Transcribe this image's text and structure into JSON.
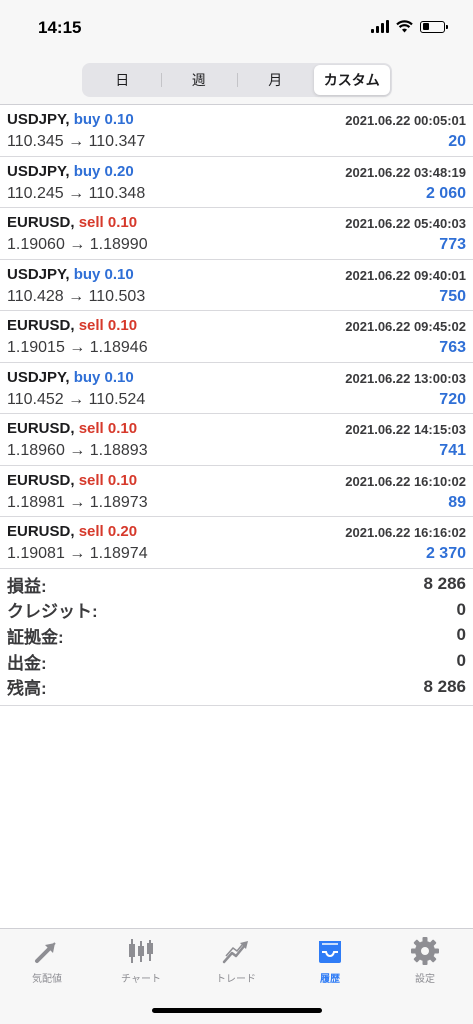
{
  "status": {
    "time": "14:15"
  },
  "tabs_period": [
    {
      "label": "日",
      "active": false
    },
    {
      "label": "週",
      "active": false
    },
    {
      "label": "月",
      "active": false
    },
    {
      "label": "カスタム",
      "active": true
    }
  ],
  "deals": [
    {
      "symbol": "USDJPY,",
      "side": "buy",
      "volume": "buy 0.10",
      "open": "110.345",
      "close": "110.347",
      "time": "2021.06.22 00:05:01",
      "profit": "20"
    },
    {
      "symbol": "USDJPY,",
      "side": "buy",
      "volume": "buy 0.20",
      "open": "110.245",
      "close": "110.348",
      "time": "2021.06.22 03:48:19",
      "profit": "2 060"
    },
    {
      "symbol": "EURUSD,",
      "side": "sell",
      "volume": "sell 0.10",
      "open": "1.19060",
      "close": "1.18990",
      "time": "2021.06.22 05:40:03",
      "profit": "773"
    },
    {
      "symbol": "USDJPY,",
      "side": "buy",
      "volume": "buy 0.10",
      "open": "110.428",
      "close": "110.503",
      "time": "2021.06.22 09:40:01",
      "profit": "750"
    },
    {
      "symbol": "EURUSD,",
      "side": "sell",
      "volume": "sell 0.10",
      "open": "1.19015",
      "close": "1.18946",
      "time": "2021.06.22 09:45:02",
      "profit": "763"
    },
    {
      "symbol": "USDJPY,",
      "side": "buy",
      "volume": "buy 0.10",
      "open": "110.452",
      "close": "110.524",
      "time": "2021.06.22 13:00:03",
      "profit": "720"
    },
    {
      "symbol": "EURUSD,",
      "side": "sell",
      "volume": "sell 0.10",
      "open": "1.18960",
      "close": "1.18893",
      "time": "2021.06.22 14:15:03",
      "profit": "741"
    },
    {
      "symbol": "EURUSD,",
      "side": "sell",
      "volume": "sell 0.10",
      "open": "1.18981",
      "close": "1.18973",
      "time": "2021.06.22 16:10:02",
      "profit": "89"
    },
    {
      "symbol": "EURUSD,",
      "side": "sell",
      "volume": "sell 0.20",
      "open": "1.19081",
      "close": "1.18974",
      "time": "2021.06.22 16:16:02",
      "profit": "2 370"
    }
  ],
  "arrow": "→",
  "summary": [
    {
      "label": "損益:",
      "value": "8 286"
    },
    {
      "label": "クレジット:",
      "value": "0"
    },
    {
      "label": "証拠金:",
      "value": "0"
    },
    {
      "label": "出金:",
      "value": "0"
    },
    {
      "label": "残高:",
      "value": "8 286"
    }
  ],
  "tabbar": [
    {
      "label": "気配値",
      "icon": "quotes-icon",
      "active": false
    },
    {
      "label": "チャート",
      "icon": "chart-icon",
      "active": false
    },
    {
      "label": "トレード",
      "icon": "trade-icon",
      "active": false
    },
    {
      "label": "履歴",
      "icon": "history-icon",
      "active": true
    },
    {
      "label": "設定",
      "icon": "settings-icon",
      "active": false
    }
  ],
  "colors": {
    "buy": "#2f6fd6",
    "sell": "#d6392b",
    "profit": "#2f6fd6",
    "active_tab": "#2f7cf6",
    "inactive_tab": "#8e8e93"
  }
}
